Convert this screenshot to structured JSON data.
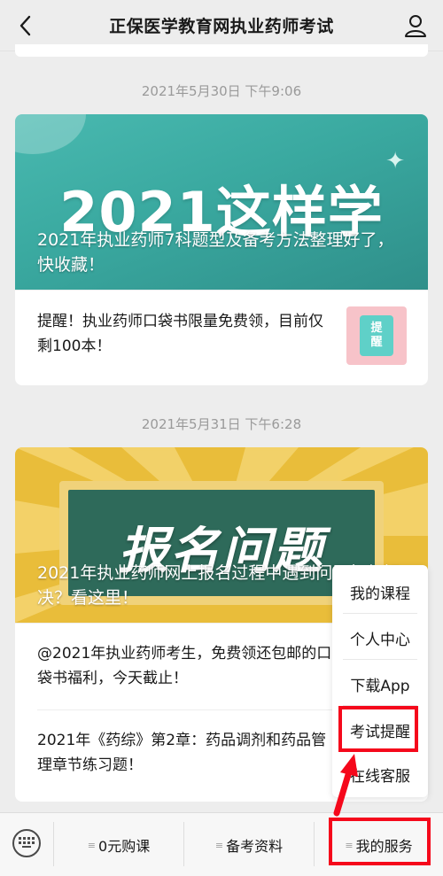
{
  "nav": {
    "title": "正保医学教育网执业药师考试"
  },
  "messages": [
    {
      "time": "2021年5月30日 下午9:06",
      "banner_big": "2021这样学",
      "banner_caption": "2021年执业药师7科题型及备考方法整理好了，快收藏！",
      "items": [
        {
          "text": "提醒！执业药师口袋书限量免费领，目前仅剩100本！",
          "thumb_text": [
            "提",
            "醒"
          ]
        }
      ]
    },
    {
      "time": "2021年5月31日 下午6:28",
      "banner_big": "报名问题",
      "banner_caption": "2021年执业药师网上报名过程中遇到问题如何解决？看这里！",
      "items": [
        {
          "text": "@2021年执业药师考生，免费领还包邮的口袋书福利，今天截止！"
        },
        {
          "text": "2021年《药综》第2章：药品调剂和药品管理章节练习题！"
        }
      ]
    }
  ],
  "popup_menu": [
    "我的课程",
    "个人中心",
    "下载App",
    "考试提醒",
    "在线客服"
  ],
  "bottom_menu": [
    {
      "label": "0元购课",
      "icon": "menu-marker"
    },
    {
      "label": "备考资料",
      "icon": "menu-marker"
    },
    {
      "label": "我的服务",
      "icon": "menu-marker"
    }
  ],
  "colors": {
    "highlight": "#f5081b",
    "banner1": "#3aa9a0",
    "banner2": "#e9bd3a"
  },
  "icons": {
    "back": "back-chevron-icon",
    "user": "user-profile-icon",
    "keyboard": "keyboard-icon"
  }
}
